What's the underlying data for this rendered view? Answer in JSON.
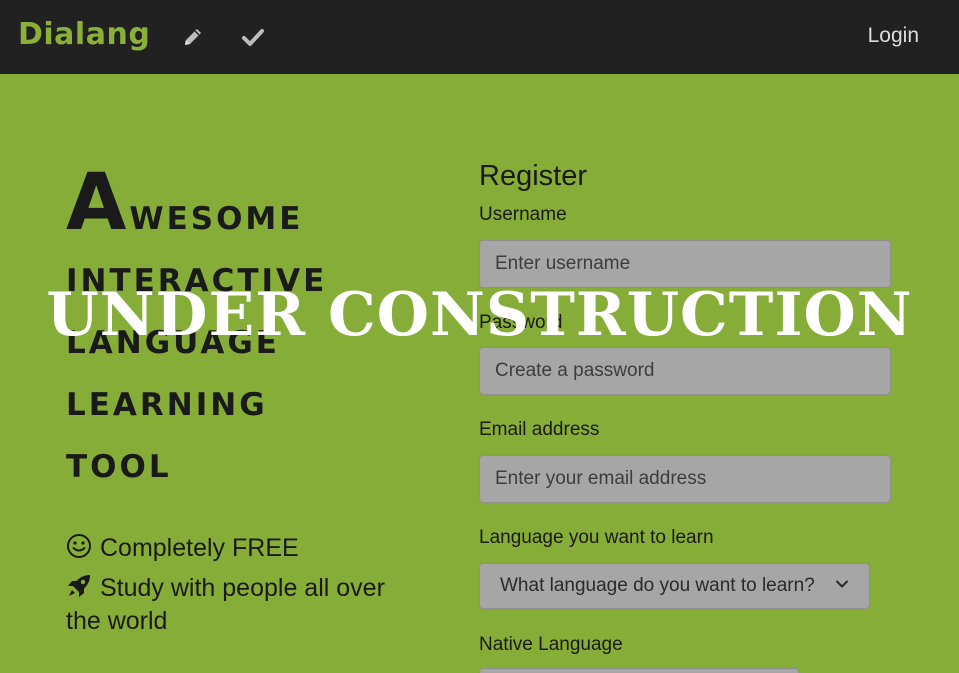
{
  "nav": {
    "brand": "Dialang",
    "icons": [
      "pencil-icon",
      "check-icon"
    ],
    "login_label": "Login"
  },
  "hero": {
    "title_first_letter": "A",
    "title_first_rest": "wesome",
    "title_lines": [
      "interactive",
      "language",
      "learning",
      "tool"
    ],
    "features": [
      {
        "icon": "smiley-icon",
        "text": "Completely FREE"
      },
      {
        "icon": "rocket-icon",
        "text": "Study with people all over the world"
      }
    ]
  },
  "register": {
    "title": "Register",
    "username_label": "Username",
    "username_placeholder": "Enter username",
    "password_label": "Password",
    "password_placeholder": "Create a password",
    "email_label": "Email address",
    "email_placeholder": "Enter your email address",
    "learn_label": "Language you want to learn",
    "learn_selected": "What language do you want to learn?",
    "native_label": "Native Language"
  },
  "overlay": {
    "text": "UNDER CONSTRUCTION"
  },
  "colors": {
    "nav_bg": "#212121",
    "page_bg": "#86ad37",
    "brand": "#8bb03a",
    "input_bg": "#a6a6a6"
  }
}
